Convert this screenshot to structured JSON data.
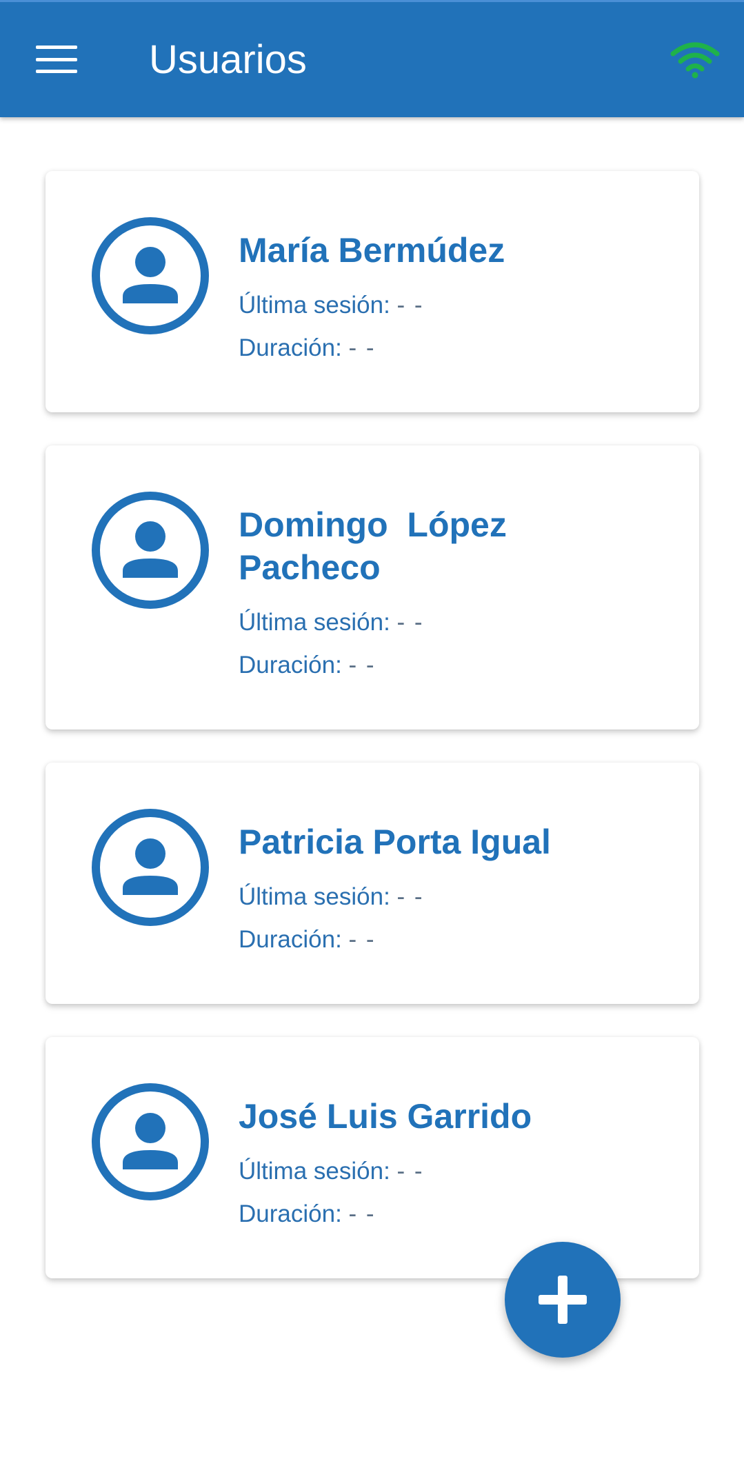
{
  "appbar": {
    "title": "Usuarios",
    "menu_icon": "hamburger-menu-icon",
    "status_icon": "wifi-icon",
    "status_color": "#1fb24a",
    "background_color": "#2172b9"
  },
  "users": [
    {
      "name": "María Bermúdez",
      "last_session_label": "Última sesión:",
      "last_session_value": "- -",
      "duration_label": "Duración:",
      "duration_value": "- -"
    },
    {
      "name": "Domingo  López Pacheco",
      "last_session_label": "Última sesión:",
      "last_session_value": "- -",
      "duration_label": "Duración:",
      "duration_value": "- -"
    },
    {
      "name": "Patricia Porta Igual",
      "last_session_label": "Última sesión:",
      "last_session_value": "- -",
      "duration_label": "Duración:",
      "duration_value": "- -"
    },
    {
      "name": "José Luis Garrido",
      "last_session_label": "Última sesión:",
      "last_session_value": "- -",
      "duration_label": "Duración:",
      "duration_value": "- -"
    }
  ],
  "fab": {
    "icon": "plus-icon"
  }
}
